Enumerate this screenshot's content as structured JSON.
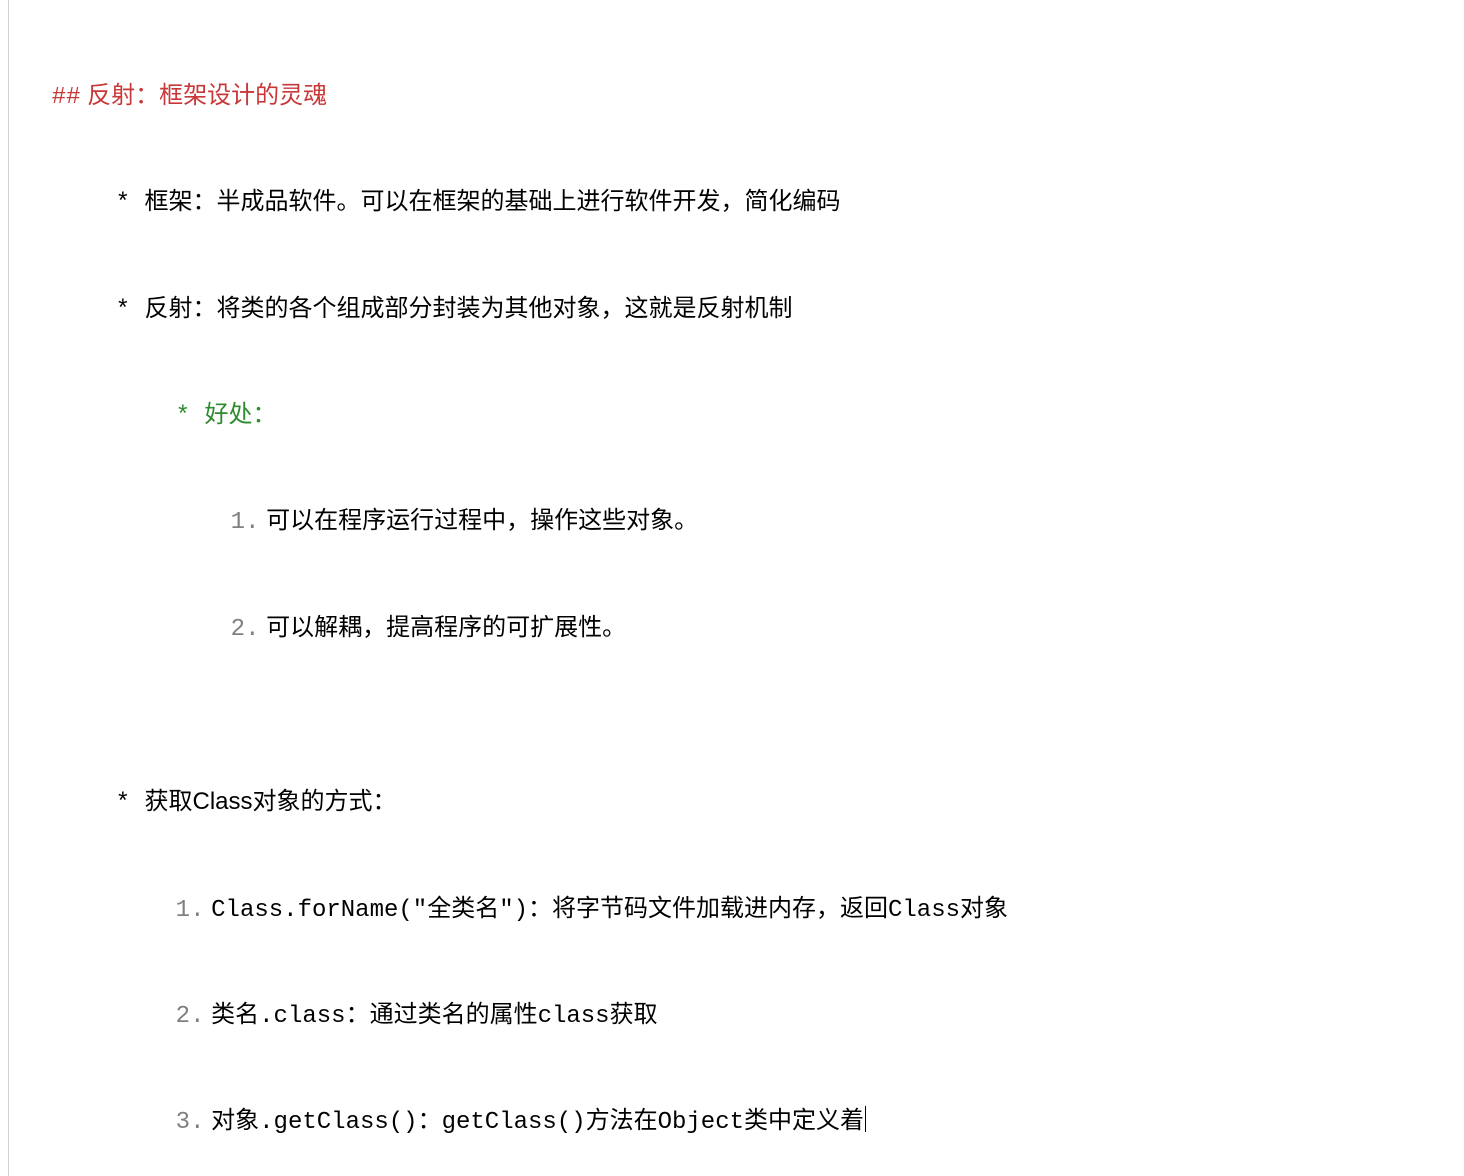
{
  "heading": {
    "mark": "##",
    "space": " ",
    "text": "反射：框架设计的灵魂"
  },
  "bullets": {
    "b1": "框架：半成品软件。可以在框架的基础上进行软件开发，简化编码",
    "b2": "反射：将类的各个组成部分封装为其他对象，这就是反射机制",
    "benefit_label": "好处：",
    "benefit1_num": "1.",
    "benefit1_text": "可以在程序运行过程中，操作这些对象。",
    "benefit2_num": "2.",
    "benefit2_text": "可以解耦，提高程序的可扩展性。"
  },
  "getclass": {
    "title": "获取Class对象的方式：",
    "m1_num": "1.",
    "m1_text": "Class.forName(\"全类名\")：将字节码文件加载进内存，返回Class对象",
    "m2_num": "2.",
    "m2_text": "类名.class：通过类名的属性class获取",
    "m3_num": "3.",
    "m3_text": "对象.getClass()：getClass()方法在Object类中定义着"
  }
}
